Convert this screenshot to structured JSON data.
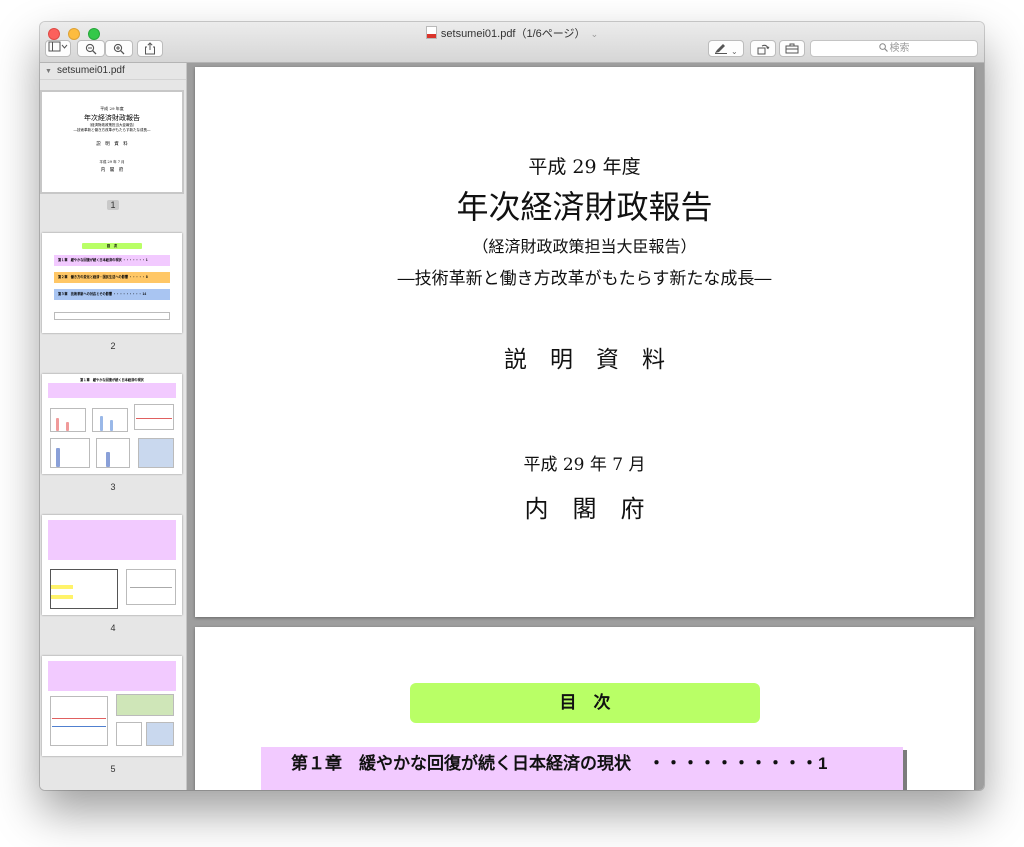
{
  "window": {
    "title": "setsumei01.pdf（1/6ページ）",
    "search_placeholder": "検索"
  },
  "sidebar": {
    "file_label": "setsumei01.pdf",
    "pages": [
      "1",
      "2",
      "3",
      "4",
      "5"
    ],
    "selected_page": "1"
  },
  "cover": {
    "year": "平成 29 年度",
    "title": "年次経済財政報告",
    "subtitle": "（経済財政政策担当大臣報告）",
    "tagline": "―技術革新と働き方改革がもたらす新たな成長―",
    "doc_type": "説　明　資　料",
    "date": "平成 29 年 7 月",
    "org": "内　閣　府"
  },
  "toc": {
    "title": "目　次",
    "chapter1": "第１章　緩やかな回復が続く日本経済の現状　・・・・・・・・・・1"
  },
  "thumb1": {
    "year": "平成 29 年度",
    "title": "年次経済財政報告",
    "subtitle": "（経済財政政策担当大臣報告）",
    "tagline": "―技術革新と働き方改革がもたらす新たな成長―",
    "doc_type": "説　明　資　料",
    "date": "平成 29 年 7 月",
    "org": "内　閣　府"
  },
  "thumb2": {
    "title": "目　次",
    "ch1": "第１章　緩やかな回復が続く日本経済の現状 ・・・・・・・ 1",
    "ch2": "第２章　働き方の変化と経済・国民生活への影響 ・・・・・ 8",
    "ch3": "第３章　技術革新への対応とその影響 ・・・・・・・・・ 14"
  },
  "thumb3": {
    "title": "第１章　緩やかな回復が続く日本経済の現状"
  },
  "colors": {
    "toc_green": "#b9ff66",
    "chapter_pink": "#f2caff",
    "chapter_orange": "#ffc766",
    "chapter_blue": "#a9c5f2"
  }
}
